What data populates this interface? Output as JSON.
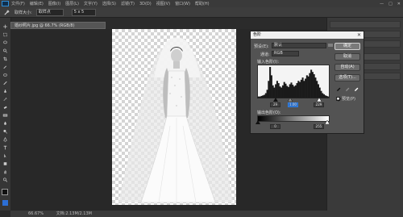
{
  "menubar": {
    "items": [
      "文件(F)",
      "编辑(E)",
      "图像(I)",
      "图层(L)",
      "文字(Y)",
      "选择(S)",
      "滤镜(T)",
      "3D(D)",
      "视图(V)",
      "窗口(W)",
      "帮助(H)"
    ]
  },
  "window_controls": {
    "minimize": "—",
    "maximize": "□",
    "close": "✕"
  },
  "options": {
    "mode_label": "取样大小:",
    "mode_value": "取样点",
    "size_label": "",
    "size_value": "5 x 5"
  },
  "document": {
    "tab_title": "婚纱照片.jpg @ 66.7% (RGB/8)",
    "close": "×"
  },
  "status": {
    "zoom": "66.67%",
    "info": "文档:2.13M/2.13M"
  },
  "right_dock": {
    "rows": [
      "",
      "",
      "",
      "图层",
      "通道",
      "路径"
    ]
  },
  "levels_dialog": {
    "title": "色阶",
    "close": "✕",
    "preset_label": "预设(E):",
    "preset_value": "默认",
    "channel_label": "通道:",
    "channel_value": "RGB",
    "input_label": "输入色阶(I):",
    "input_black": "29",
    "input_gray": "1.00",
    "input_white": "229",
    "output_label": "输出色阶(O):",
    "output_black": "0",
    "output_white": "255",
    "buttons": {
      "ok": "确定",
      "cancel": "取消",
      "auto": "自动(A)",
      "options": "选项(T)..."
    },
    "preview_label": "预览(P)",
    "preview_checked": true,
    "histogram": [
      2,
      2,
      3,
      4,
      5,
      8,
      14,
      30,
      55,
      40,
      22,
      18,
      24,
      30,
      26,
      20,
      18,
      22,
      28,
      25,
      21,
      19,
      24,
      27,
      23,
      20,
      22,
      26,
      30,
      28,
      32,
      36,
      30,
      34,
      40,
      38,
      44,
      50,
      46,
      42,
      36,
      30,
      24,
      18,
      12,
      8,
      6,
      4,
      3,
      2
    ]
  }
}
